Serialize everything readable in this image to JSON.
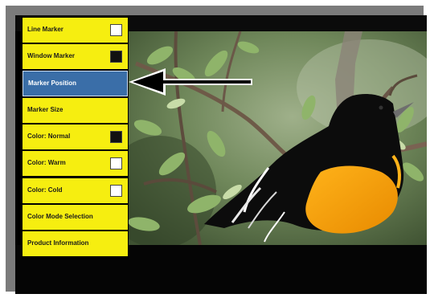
{
  "menu": {
    "items": [
      {
        "label": "Line Marker",
        "swatch": "#ffffff"
      },
      {
        "label": "Window Marker",
        "swatch": "#111111"
      },
      {
        "label": "Marker Position",
        "selected": true
      },
      {
        "label": "Marker Size"
      },
      {
        "label": "Color: Normal",
        "swatch": "#111111"
      },
      {
        "label": "Color: Warm",
        "swatch": "#ffffff"
      },
      {
        "label": "Color: Cold",
        "swatch": "#ffffff"
      },
      {
        "label": "Color Mode Selection"
      },
      {
        "label": "Product Information"
      }
    ]
  },
  "colors": {
    "menu_item": "#f6ee10",
    "selected_item": "#3a6ea8",
    "frame": "#7b7b7b",
    "screen": "#000000"
  },
  "icons": {
    "pointer": "left-arrow-icon",
    "photo": "oriole-photo"
  }
}
